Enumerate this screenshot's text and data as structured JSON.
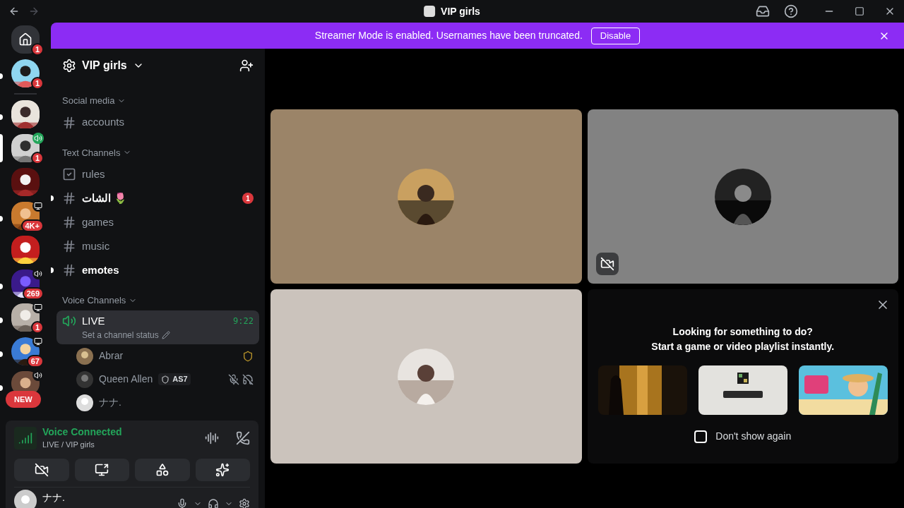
{
  "window": {
    "title": "VIP girls"
  },
  "banner": {
    "text": "Streamer Mode is enabled. Usernames have been truncated.",
    "button": "Disable"
  },
  "servers": [
    {
      "kind": "home",
      "badge": "1",
      "speaker": false,
      "streaming": false,
      "unread": false,
      "selected": false
    },
    {
      "kind": "picture",
      "badge": "1",
      "speaker": false,
      "streaming": false,
      "unread": true,
      "selected": false
    },
    {
      "kind": "picture",
      "speaker": false,
      "streaming": false,
      "unread": true,
      "selected": false
    },
    {
      "kind": "picture",
      "badge": "1",
      "speaker": true,
      "streaming": false,
      "unread": false,
      "selected": true
    },
    {
      "kind": "picture",
      "speaker": false,
      "streaming": false,
      "unread": false,
      "selected": false
    },
    {
      "kind": "picture",
      "badge": "4K+",
      "speaker": false,
      "streaming": true,
      "unread": true,
      "selected": false
    },
    {
      "kind": "picture",
      "speaker": false,
      "streaming": false,
      "unread": false,
      "selected": false
    },
    {
      "kind": "picture",
      "badge": "269",
      "speaker": true,
      "streaming": false,
      "unread": true,
      "selected": false
    },
    {
      "kind": "picture",
      "badge": "1",
      "speaker": false,
      "streaming": true,
      "unread": true,
      "selected": false
    },
    {
      "kind": "picture",
      "badge": "67",
      "speaker": false,
      "streaming": true,
      "unread": true,
      "selected": false
    },
    {
      "kind": "picture",
      "speaker": true,
      "streaming": false,
      "unread": true,
      "selected": false
    }
  ],
  "new_pill": "NEW",
  "server": {
    "name": "VIP girls"
  },
  "categories": [
    {
      "name": "Social media",
      "channels": [
        {
          "kind": "text",
          "name": "accounts",
          "unread": false
        }
      ]
    },
    {
      "name": "Text Channels",
      "channels": [
        {
          "kind": "rules",
          "name": "rules",
          "unread": false
        },
        {
          "kind": "text",
          "name": "الشات 🌷",
          "unread": true,
          "mentions": "1"
        },
        {
          "kind": "text",
          "name": "games",
          "unread": false
        },
        {
          "kind": "text",
          "name": "music",
          "unread": false
        },
        {
          "kind": "text",
          "name": "emotes",
          "unread": true
        }
      ]
    }
  ],
  "voice_category": {
    "name": "Voice Channels",
    "channel": {
      "name": "LIVE",
      "time": "9:22",
      "status_hint": "Set a channel status",
      "selected": true
    },
    "members": [
      {
        "name": "Abrar",
        "shield": true,
        "muted": false,
        "deafened": false
      },
      {
        "name": "Queen Allen",
        "tag": "AS7",
        "shield": false,
        "muted": true,
        "deafened": true
      },
      {
        "name": "ナナ.",
        "shield": false,
        "muted": false,
        "deafened": false
      }
    ]
  },
  "voice_panel": {
    "status": "Voice Connected",
    "location": "LIVE / VIP girls"
  },
  "user": {
    "name": "ナナ."
  },
  "tiles": [
    {
      "camera_off": false
    },
    {
      "camera_off": true
    },
    {
      "camera_off": false
    }
  ],
  "activity": {
    "heading": "Looking for something to do?",
    "subheading": "Start a game or video playlist instantly.",
    "games": [
      {
        "kind": "picture"
      },
      {
        "kind": "picture"
      },
      {
        "kind": "picture"
      }
    ],
    "dont_show": {
      "label": "Don't show again",
      "checked": false
    }
  }
}
